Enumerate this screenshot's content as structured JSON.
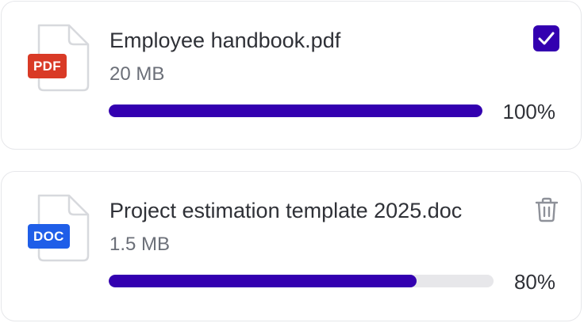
{
  "colors": {
    "accent": "#3300b0",
    "track": "#e7e7ea",
    "pdf_badge": "#d93a26",
    "doc_badge": "#1f5ee8"
  },
  "files": [
    {
      "badge": "PDF",
      "icon": "pdf-file-icon",
      "name": "Employee handbook.pdf",
      "size": "20 MB",
      "progress": 100,
      "progress_label": "100%",
      "action_icon": "checkbox-checked-icon"
    },
    {
      "badge": "DOC",
      "icon": "doc-file-icon",
      "name": "Project estimation template 2025.doc",
      "size": "1.5 MB",
      "progress": 80,
      "progress_label": "80%",
      "action_icon": "trash-icon"
    }
  ]
}
